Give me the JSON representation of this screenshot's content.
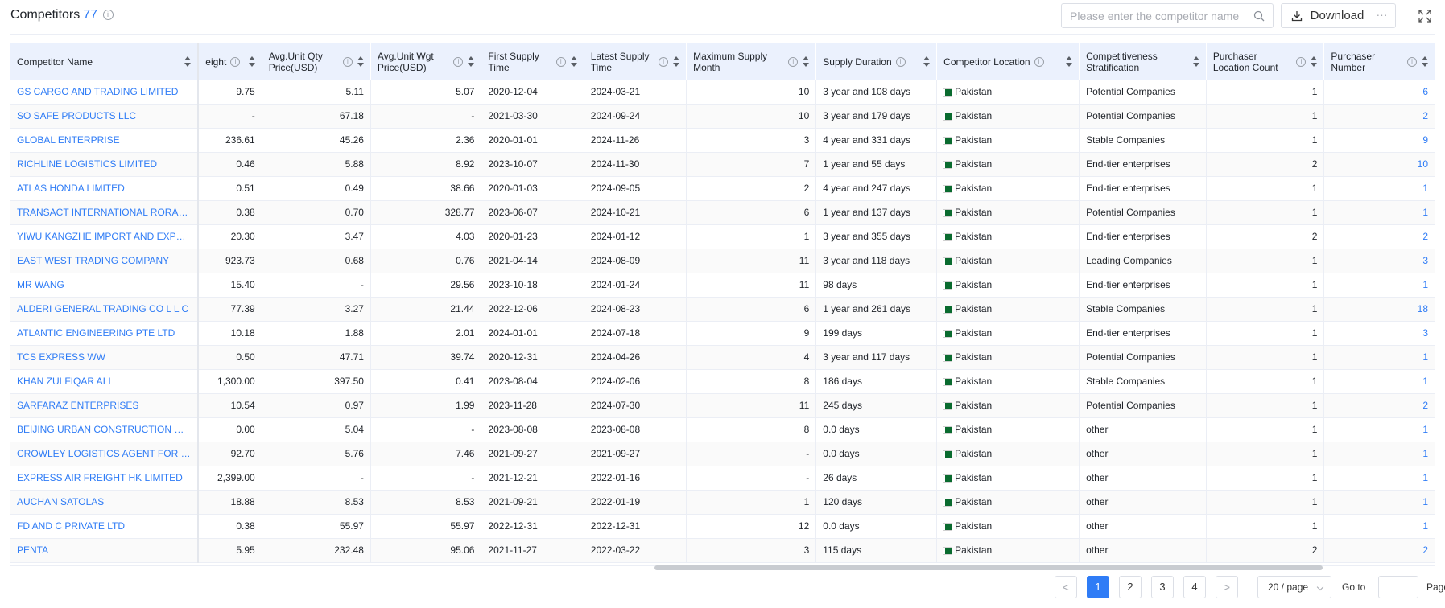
{
  "header": {
    "title": "Competitors",
    "count": "77",
    "search_placeholder": "Please enter the competitor name",
    "download_label": "Download",
    "more_label": "···"
  },
  "table": {
    "fixed_column": "Competitor Name",
    "columns": [
      "eight",
      "Avg.Unit Qty Price(USD)",
      "Avg.Unit Wgt Price(USD)",
      "First Supply Time",
      "Latest Supply Time",
      "Maximum Supply Month",
      "Supply Duration",
      "Competitor Location",
      "Competitiveness Stratification",
      "Purchaser Location Count",
      "Purchaser Number"
    ],
    "rows": [
      {
        "name": "GS CARGO AND TRADING LIMITED",
        "weight": "9.75",
        "qty_price": "5.11",
        "wgt_price": "5.07",
        "first": "2020-12-04",
        "latest": "2024-03-21",
        "max_month": "10",
        "duration": "3 year and 108 days",
        "location": "Pakistan",
        "strat": "Potential Companies",
        "loc_count": "1",
        "purchasers": "6"
      },
      {
        "name": "SO SAFE PRODUCTS LLC",
        "weight": "-",
        "qty_price": "67.18",
        "wgt_price": "-",
        "first": "2021-03-30",
        "latest": "2024-09-24",
        "max_month": "10",
        "duration": "3 year and 179 days",
        "location": "Pakistan",
        "strat": "Potential Companies",
        "loc_count": "1",
        "purchasers": "2"
      },
      {
        "name": "GLOBAL ENTERPRISE",
        "weight": "236.61",
        "qty_price": "45.26",
        "wgt_price": "2.36",
        "first": "2020-01-01",
        "latest": "2024-11-26",
        "max_month": "3",
        "duration": "4 year and 331 days",
        "location": "Pakistan",
        "strat": "Stable Companies",
        "loc_count": "1",
        "purchasers": "9"
      },
      {
        "name": "RICHLINE LOGISTICS LIMITED",
        "weight": "0.46",
        "qty_price": "5.88",
        "wgt_price": "8.92",
        "first": "2023-10-07",
        "latest": "2024-11-30",
        "max_month": "7",
        "duration": "1 year and 55 days",
        "location": "Pakistan",
        "strat": "End-tier enterprises",
        "loc_count": "2",
        "purchasers": "10"
      },
      {
        "name": "ATLAS HONDA LIMITED",
        "weight": "0.51",
        "qty_price": "0.49",
        "wgt_price": "38.66",
        "first": "2020-01-03",
        "latest": "2024-09-05",
        "max_month": "2",
        "duration": "4 year and 247 days",
        "location": "Pakistan",
        "strat": "End-tier enterprises",
        "loc_count": "1",
        "purchasers": "1"
      },
      {
        "name": "TRANSACT INTERNATIONAL RORAS ...",
        "weight": "0.38",
        "qty_price": "0.70",
        "wgt_price": "328.77",
        "first": "2023-06-07",
        "latest": "2024-10-21",
        "max_month": "6",
        "duration": "1 year and 137 days",
        "location": "Pakistan",
        "strat": "Potential Companies",
        "loc_count": "1",
        "purchasers": "1"
      },
      {
        "name": "YIWU KANGZHE IMPORT AND EXPOR...",
        "weight": "20.30",
        "qty_price": "3.47",
        "wgt_price": "4.03",
        "first": "2020-01-23",
        "latest": "2024-01-12",
        "max_month": "1",
        "duration": "3 year and 355 days",
        "location": "Pakistan",
        "strat": "End-tier enterprises",
        "loc_count": "2",
        "purchasers": "2"
      },
      {
        "name": "EAST WEST TRADING COMPANY",
        "weight": "923.73",
        "qty_price": "0.68",
        "wgt_price": "0.76",
        "first": "2021-04-14",
        "latest": "2024-08-09",
        "max_month": "11",
        "duration": "3 year and 118 days",
        "location": "Pakistan",
        "strat": "Leading Companies",
        "loc_count": "1",
        "purchasers": "3"
      },
      {
        "name": "MR WANG",
        "weight": "15.40",
        "qty_price": "-",
        "wgt_price": "29.56",
        "first": "2023-10-18",
        "latest": "2024-01-24",
        "max_month": "11",
        "duration": "98 days",
        "location": "Pakistan",
        "strat": "End-tier enterprises",
        "loc_count": "1",
        "purchasers": "1"
      },
      {
        "name": "ALDERI GENERAL TRADING CO L L C",
        "weight": "77.39",
        "qty_price": "3.27",
        "wgt_price": "21.44",
        "first": "2022-12-06",
        "latest": "2024-08-23",
        "max_month": "6",
        "duration": "1 year and 261 days",
        "location": "Pakistan",
        "strat": "Stable Companies",
        "loc_count": "1",
        "purchasers": "18"
      },
      {
        "name": "ATLANTIC ENGINEERING PTE LTD",
        "weight": "10.18",
        "qty_price": "1.88",
        "wgt_price": "2.01",
        "first": "2024-01-01",
        "latest": "2024-07-18",
        "max_month": "9",
        "duration": "199 days",
        "location": "Pakistan",
        "strat": "End-tier enterprises",
        "loc_count": "1",
        "purchasers": "3"
      },
      {
        "name": "TCS EXPRESS WW",
        "weight": "0.50",
        "qty_price": "47.71",
        "wgt_price": "39.74",
        "first": "2020-12-31",
        "latest": "2024-04-26",
        "max_month": "4",
        "duration": "3 year and 117 days",
        "location": "Pakistan",
        "strat": "Potential Companies",
        "loc_count": "1",
        "purchasers": "1"
      },
      {
        "name": "KHAN ZULFIQAR ALI",
        "weight": "1,300.00",
        "qty_price": "397.50",
        "wgt_price": "0.41",
        "first": "2023-08-04",
        "latest": "2024-02-06",
        "max_month": "8",
        "duration": "186 days",
        "location": "Pakistan",
        "strat": "Stable Companies",
        "loc_count": "1",
        "purchasers": "1"
      },
      {
        "name": "SARFARAZ ENTERPRISES",
        "weight": "10.54",
        "qty_price": "0.97",
        "wgt_price": "1.99",
        "first": "2023-11-28",
        "latest": "2024-07-30",
        "max_month": "11",
        "duration": "245 days",
        "location": "Pakistan",
        "strat": "Potential Companies",
        "loc_count": "1",
        "purchasers": "2"
      },
      {
        "name": "BEIJING URBAN CONSTRUCTION GR...",
        "weight": "0.00",
        "qty_price": "5.04",
        "wgt_price": "-",
        "first": "2023-08-08",
        "latest": "2023-08-08",
        "max_month": "8",
        "duration": "0.0 days",
        "location": "Pakistan",
        "strat": "other",
        "loc_count": "1",
        "purchasers": "1"
      },
      {
        "name": "CROWLEY LOGISTICS AGENT FOR CO...",
        "weight": "92.70",
        "qty_price": "5.76",
        "wgt_price": "7.46",
        "first": "2021-09-27",
        "latest": "2021-09-27",
        "max_month": "-",
        "duration": "0.0 days",
        "location": "Pakistan",
        "strat": "other",
        "loc_count": "1",
        "purchasers": "1"
      },
      {
        "name": "EXPRESS AIR FREIGHT HK LIMITED",
        "weight": "2,399.00",
        "qty_price": "-",
        "wgt_price": "-",
        "first": "2021-12-21",
        "latest": "2022-01-16",
        "max_month": "-",
        "duration": "26 days",
        "location": "Pakistan",
        "strat": "other",
        "loc_count": "1",
        "purchasers": "1"
      },
      {
        "name": "AUCHAN SATOLAS",
        "weight": "18.88",
        "qty_price": "8.53",
        "wgt_price": "8.53",
        "first": "2021-09-21",
        "latest": "2022-01-19",
        "max_month": "1",
        "duration": "120 days",
        "location": "Pakistan",
        "strat": "other",
        "loc_count": "1",
        "purchasers": "1"
      },
      {
        "name": "FD AND C PRIVATE LTD",
        "weight": "0.38",
        "qty_price": "55.97",
        "wgt_price": "55.97",
        "first": "2022-12-31",
        "latest": "2022-12-31",
        "max_month": "12",
        "duration": "0.0 days",
        "location": "Pakistan",
        "strat": "other",
        "loc_count": "1",
        "purchasers": "1"
      },
      {
        "name": "PENTA",
        "weight": "5.95",
        "qty_price": "232.48",
        "wgt_price": "95.06",
        "first": "2021-11-27",
        "latest": "2022-03-22",
        "max_month": "3",
        "duration": "115 days",
        "location": "Pakistan",
        "strat": "other",
        "loc_count": "2",
        "purchasers": "2"
      }
    ]
  },
  "pagination": {
    "prev": "<",
    "pages": [
      "1",
      "2",
      "3",
      "4"
    ],
    "active_page": "1",
    "next": ">",
    "page_size": "20 / page",
    "goto_label": "Go to",
    "page_label": "Page"
  },
  "icons": [
    "info-icon",
    "search-icon",
    "download-icon",
    "expand-icon",
    "sort-icon",
    "pakistan-flag-icon"
  ],
  "colors": {
    "accent": "#2f7cf6",
    "header_bg": "#ebf1fd",
    "flag": "#0a6b2f"
  }
}
